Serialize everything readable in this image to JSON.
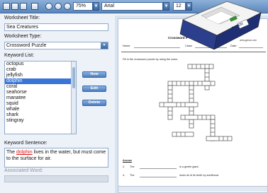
{
  "toolbar": {
    "zoom": "75%",
    "font": "Arial",
    "font_size": "12",
    "icons": [
      "new-doc-icon",
      "open-icon",
      "save-icon",
      "print-icon",
      "zoom-in-icon",
      "zoom-out-icon",
      "zoom-fit-icon"
    ]
  },
  "form": {
    "worksheet_title_label": "Worksheet Title:",
    "worksheet_title_value": "Sea Creatures",
    "worksheet_type_label": "Worksheet Type:",
    "worksheet_type_value": "Crossword Puzzle",
    "keyword_list_label": "Keyword List:",
    "keywords": [
      "octopus",
      "crab",
      "jellyfish",
      "dolphin",
      "coral",
      "seahorse",
      "manatee",
      "squid",
      "whale",
      "shark",
      "stingray"
    ],
    "selected_keyword": "dolphin",
    "buttons": {
      "new": "New",
      "edit": "Edit",
      "delete": "Delete"
    },
    "keyword_sentence_label": "Keyword Sentence:",
    "sentence_before": "The ",
    "sentence_keyword": "dolphin",
    "sentence_after": " lives in the water, but must come to the surface for air.",
    "associated_word_label": "Associated Word:"
  },
  "preview": {
    "title": "Crossword P",
    "name_label": "Name:",
    "class_label": "Class:",
    "date_label": "Date:",
    "instructions": "Fill in the crossword puzzle by using the clues.",
    "across_label": "Across",
    "clue_2_number": "2.",
    "clue_2_start": "The",
    "clue_2_end": "is a gentle giant.",
    "clue_4_number": "4.",
    "clue_4_start": "The",
    "clue_4_end": "loses all of its teeth by adulthood.",
    "box_brand": "GAMCO",
    "box_url": "www.gamco.com"
  }
}
